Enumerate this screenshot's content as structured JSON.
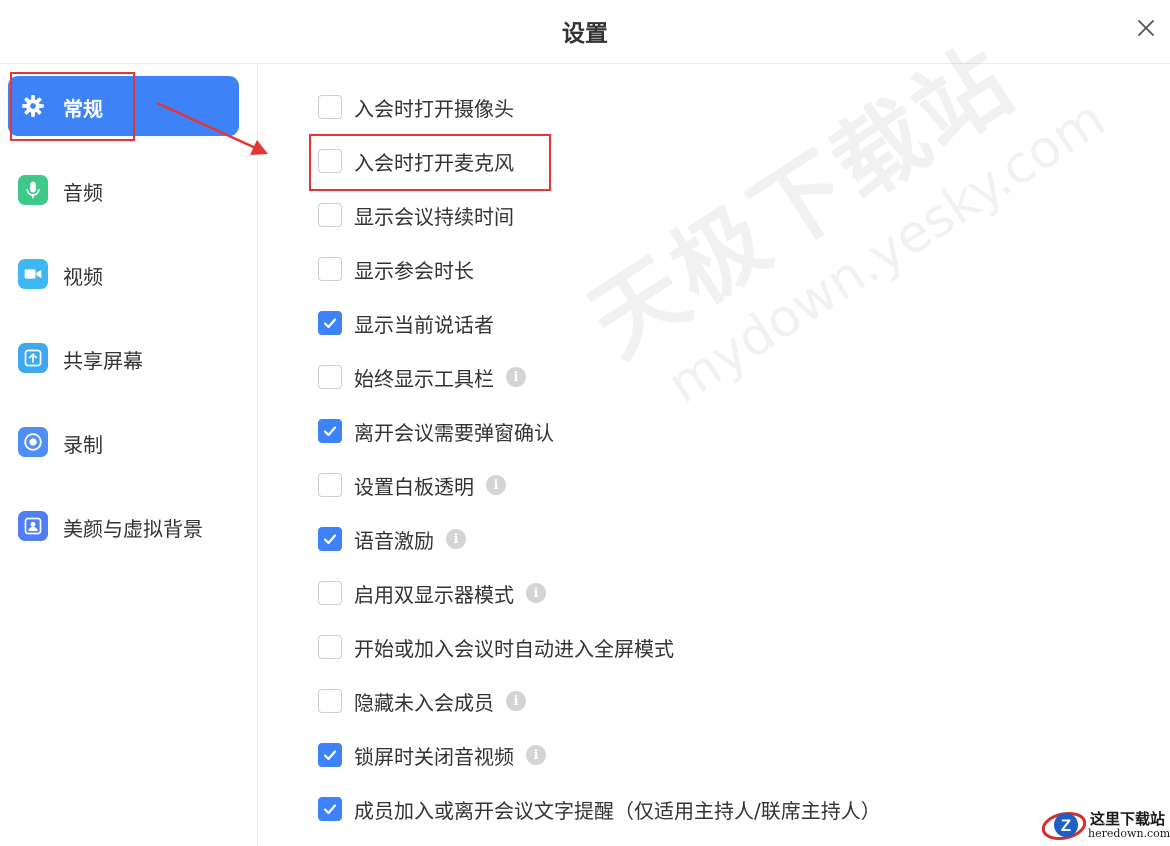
{
  "window": {
    "title": "设置"
  },
  "sidebar": {
    "items": [
      {
        "label": "常规",
        "icon": "gear-icon",
        "active": true,
        "icon_color": "#3d83f7"
      },
      {
        "label": "音频",
        "icon": "microphone-icon",
        "active": false,
        "icon_color": "#3ec98a"
      },
      {
        "label": "视频",
        "icon": "video-camera-icon",
        "active": false,
        "icon_color": "#3fb7f0"
      },
      {
        "label": "共享屏幕",
        "icon": "share-screen-icon",
        "active": false,
        "icon_color": "#3fa8f0"
      },
      {
        "label": "录制",
        "icon": "record-icon",
        "active": false,
        "icon_color": "#4f8ef7"
      },
      {
        "label": "美颜与虚拟背景",
        "icon": "portrait-icon",
        "active": false,
        "icon_color": "#4f7ef7"
      }
    ]
  },
  "options": [
    {
      "label": "入会时打开摄像头",
      "checked": false,
      "info": false
    },
    {
      "label": "入会时打开麦克风",
      "checked": false,
      "info": false
    },
    {
      "label": "显示会议持续时间",
      "checked": false,
      "info": false
    },
    {
      "label": "显示参会时长",
      "checked": false,
      "info": false
    },
    {
      "label": "显示当前说话者",
      "checked": true,
      "info": false
    },
    {
      "label": "始终显示工具栏",
      "checked": false,
      "info": true
    },
    {
      "label": "离开会议需要弹窗确认",
      "checked": true,
      "info": false
    },
    {
      "label": "设置白板透明",
      "checked": false,
      "info": true
    },
    {
      "label": "语音激励",
      "checked": true,
      "info": true
    },
    {
      "label": "启用双显示器模式",
      "checked": false,
      "info": true
    },
    {
      "label": "开始或加入会议时自动进入全屏模式",
      "checked": false,
      "info": false
    },
    {
      "label": "隐藏未入会成员",
      "checked": false,
      "info": true
    },
    {
      "label": "锁屏时关闭音视频",
      "checked": true,
      "info": true
    },
    {
      "label": "成员加入或离开会议文字提醒（仅适用主持人/联席主持人）",
      "checked": true,
      "info": false
    }
  ],
  "info_glyph": "i",
  "watermark": {
    "line1": "天极下载站",
    "line2": "mydown.yesky.com"
  },
  "logo": {
    "line1": "这里下载站",
    "line2": "heredown.com"
  },
  "colors": {
    "accent": "#3d83f7",
    "annotation": "#e53535",
    "checkbox_border": "#cfcfcf"
  }
}
